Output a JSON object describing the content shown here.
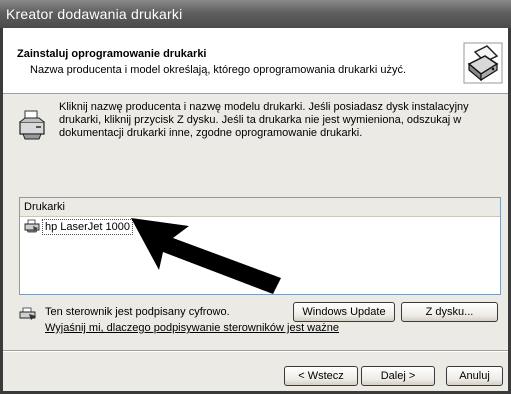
{
  "window": {
    "title": "Kreator dodawania drukarki"
  },
  "header": {
    "title": "Zainstaluj oprogramowanie drukarki",
    "subtitle": "Nazwa producenta i model określają, którego oprogramowania drukarki użyć.",
    "icon": "printer-wizard-icon"
  },
  "intro": {
    "icon": "printer-icon",
    "text": "Kliknij nazwę producenta i nazwę modelu drukarki. Jeśli posiadasz dysk instalacyjny drukarki, kliknij przycisk Z dysku. Jeśli ta drukarka nie jest wymieniona, odszukaj w dokumentacji drukarki inne, zgodne oprogramowanie drukarki."
  },
  "printers": {
    "header": "Drukarki",
    "items": [
      {
        "label": "hp LaserJet 1000",
        "icon": "printer-item-icon",
        "selected": true
      }
    ]
  },
  "driver": {
    "signed_text": "Ten sterownik jest podpisany cyfrowo.",
    "why_link": "Wyjaśnij mi, dlaczego podpisywanie sterowników jest ważne",
    "icon": "signed-driver-icon"
  },
  "buttons": {
    "windows_update": "Windows Update",
    "have_disk": "Z dysku...",
    "back": "< Wstecz",
    "next": "Dalej >",
    "cancel": "Anuluj"
  }
}
